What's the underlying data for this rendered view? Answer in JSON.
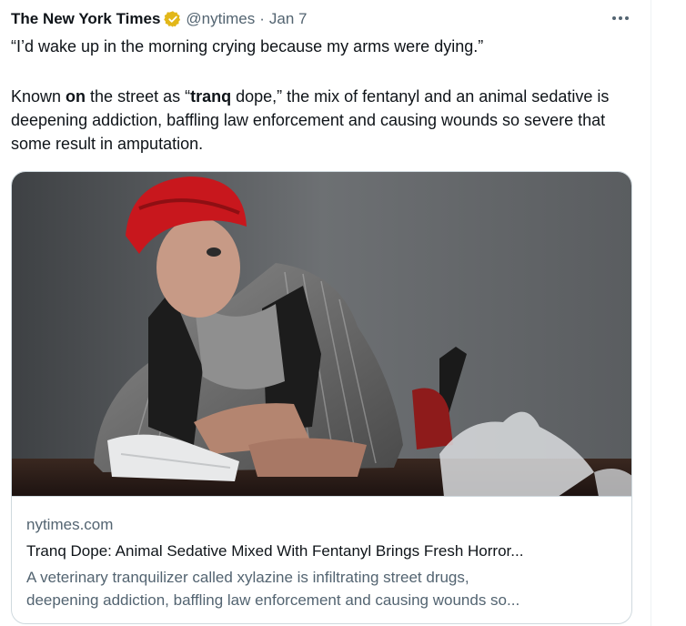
{
  "tweet": {
    "author_name": "The New York Times",
    "handle": "@nytimes",
    "separator": "·",
    "date": "Jan 7",
    "line1": "“I’d wake up in the morning crying because my arms were dying.”",
    "para2_parts": [
      "Known ",
      "on",
      " the street as “",
      "tranq",
      " dope,” the mix of fentanyl and an animal sedative is deepening addiction, baffling law enforcement and causing wounds so severe that some result in amputation."
    ]
  },
  "card": {
    "domain": "nytimes.com",
    "title": "Tranq Dope: Animal Sedative Mixed With Fentanyl Brings Fresh Horror...",
    "description_line1": "A veterinary tranquilizer called xylazine is infiltrating street drugs,",
    "description_line2": "deepening addiction, baffling law enforcement and causing wounds so..."
  },
  "icons": {
    "verified": "verified-gold-badge-icon",
    "more": "more-options-icon"
  },
  "colors": {
    "primary_text": "#0f1419",
    "secondary_text": "#536471",
    "border": "#cfd9de",
    "verified_gold": "#e2b719"
  }
}
